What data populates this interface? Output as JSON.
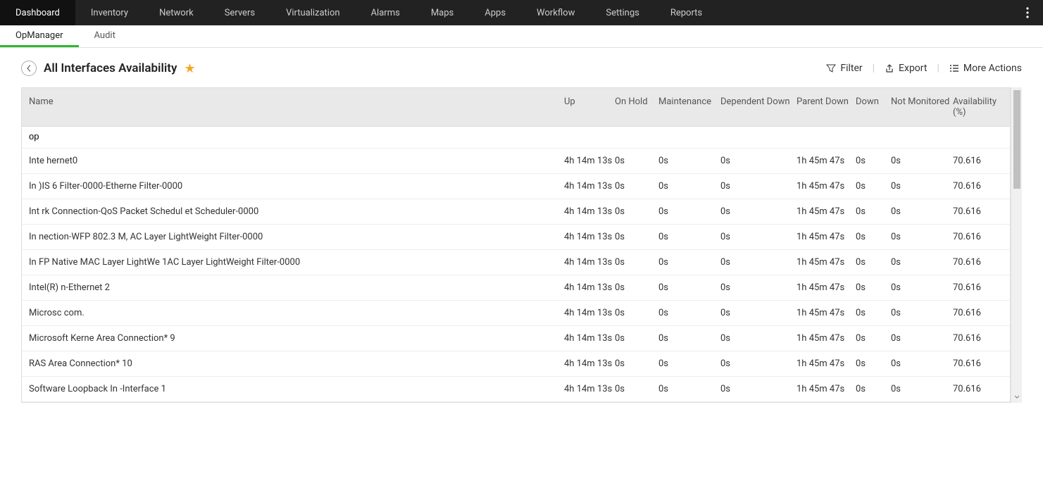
{
  "topNav": {
    "items": [
      "Dashboard",
      "Inventory",
      "Network",
      "Servers",
      "Virtualization",
      "Alarms",
      "Maps",
      "Apps",
      "Workflow",
      "Settings",
      "Reports"
    ],
    "activeIndex": 0
  },
  "subNav": {
    "items": [
      "OpManager",
      "Audit"
    ],
    "activeIndex": 0
  },
  "page": {
    "title": "All Interfaces Availability",
    "filterLabel": "Filter",
    "exportLabel": "Export",
    "moreActionsLabel": "More Actions"
  },
  "table": {
    "headers": {
      "name": "Name",
      "up": "Up",
      "onHold": "On Hold",
      "maintenance": "Maintenance",
      "dependentDown": "Dependent Down",
      "parentDown": "Parent Down",
      "down": "Down",
      "notMonitored": "Not Monitored",
      "availability": "Availability (%)"
    },
    "searchValue": "op",
    "rows": [
      {
        "name": "Inte                                                            hernet0",
        "up": "4h 14m 13s",
        "onHold": "0s",
        "maintenance": "0s",
        "dependentDown": "0s",
        "parentDown": "1h 45m 47s",
        "down": "0s",
        "notMonitored": "0s",
        "availability": "70.616"
      },
      {
        "name": "In                                                                                 )IS 6 Filter-0000-Etherne                                                          Filter-0000",
        "up": "4h 14m 13s",
        "onHold": "0s",
        "maintenance": "0s",
        "dependentDown": "0s",
        "parentDown": "1h 45m 47s",
        "down": "0s",
        "notMonitored": "0s",
        "availability": "70.616"
      },
      {
        "name": "Int                                       rk Connection-QoS Packet Schedul                                                et Scheduler-0000",
        "up": "4h 14m 13s",
        "onHold": "0s",
        "maintenance": "0s",
        "dependentDown": "0s",
        "parentDown": "1h 45m 47s",
        "down": "0s",
        "notMonitored": "0s",
        "availability": "70.616"
      },
      {
        "name": "In                                            nection-WFP 802.3 M,                                                                                 AC Layer LightWeight Filter-0000",
        "up": "4h 14m 13s",
        "onHold": "0s",
        "maintenance": "0s",
        "dependentDown": "0s",
        "parentDown": "1h 45m 47s",
        "down": "0s",
        "notMonitored": "0s",
        "availability": "70.616"
      },
      {
        "name": "In                                                          FP Native MAC Layer LightWe                                                                     1AC Layer LightWeight Filter-0000",
        "up": "4h 14m 13s",
        "onHold": "0s",
        "maintenance": "0s",
        "dependentDown": "0s",
        "parentDown": "1h 45m 47s",
        "down": "0s",
        "notMonitored": "0s",
        "availability": "70.616"
      },
      {
        "name": "Intel(R)                                                    n-Ethernet 2",
        "up": "4h 14m 13s",
        "onHold": "0s",
        "maintenance": "0s",
        "dependentDown": "0s",
        "parentDown": "1h 45m 47s",
        "down": "0s",
        "notMonitored": "0s",
        "availability": "70.616"
      },
      {
        "name": "Microsc                                                          com.",
        "up": "4h 14m 13s",
        "onHold": "0s",
        "maintenance": "0s",
        "dependentDown": "0s",
        "parentDown": "1h 45m 47s",
        "down": "0s",
        "notMonitored": "0s",
        "availability": "70.616"
      },
      {
        "name": "Microsoft Kerne                                          Area Connection* 9",
        "up": "4h 14m 13s",
        "onHold": "0s",
        "maintenance": "0s",
        "dependentDown": "0s",
        "parentDown": "1h 45m 47s",
        "down": "0s",
        "notMonitored": "0s",
        "availability": "70.616"
      },
      {
        "name": "RAS                                              Area Connection* 10",
        "up": "4h 14m 13s",
        "onHold": "0s",
        "maintenance": "0s",
        "dependentDown": "0s",
        "parentDown": "1h 45m 47s",
        "down": "0s",
        "notMonitored": "0s",
        "availability": "70.616"
      },
      {
        "name": "Software Loopback In                                     -Interface 1",
        "up": "4h 14m 13s",
        "onHold": "0s",
        "maintenance": "0s",
        "dependentDown": "0s",
        "parentDown": "1h 45m 47s",
        "down": "0s",
        "notMonitored": "0s",
        "availability": "70.616"
      }
    ]
  }
}
